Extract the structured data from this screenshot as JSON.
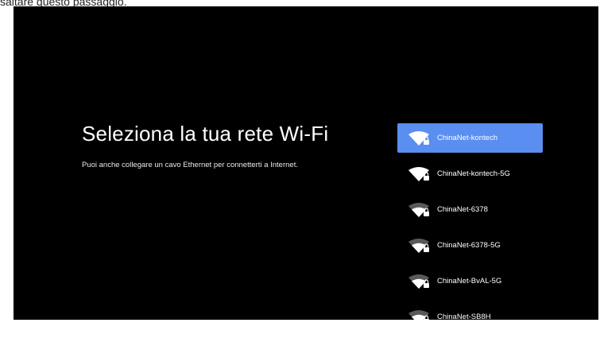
{
  "caption": "saltare questo passaggio.",
  "setup": {
    "title": "Seleziona la tua rete Wi-Fi",
    "subtitle": "Puoi anche collegare un cavo Ethernet per connetterti a Internet."
  },
  "networks": [
    {
      "ssid": "ChinaNet-kontech",
      "selected": true,
      "icon": "wifi-secured-icon"
    },
    {
      "ssid": "ChinaNet-kontech-5G",
      "selected": false,
      "icon": "wifi-secured-icon"
    },
    {
      "ssid": "ChinaNet-6378",
      "selected": false,
      "icon": "wifi-secured-icon"
    },
    {
      "ssid": "ChinaNet-6378-5G",
      "selected": false,
      "icon": "wifi-secured-icon"
    },
    {
      "ssid": "ChinaNet-BvAL-5G",
      "selected": false,
      "icon": "wifi-secured-icon"
    },
    {
      "ssid": "ChinaNet-SB8H",
      "selected": false,
      "icon": "wifi-secured-icon"
    }
  ],
  "colors": {
    "background": "#000000",
    "selection": "#5a8ef0",
    "text": "#ffffff"
  }
}
